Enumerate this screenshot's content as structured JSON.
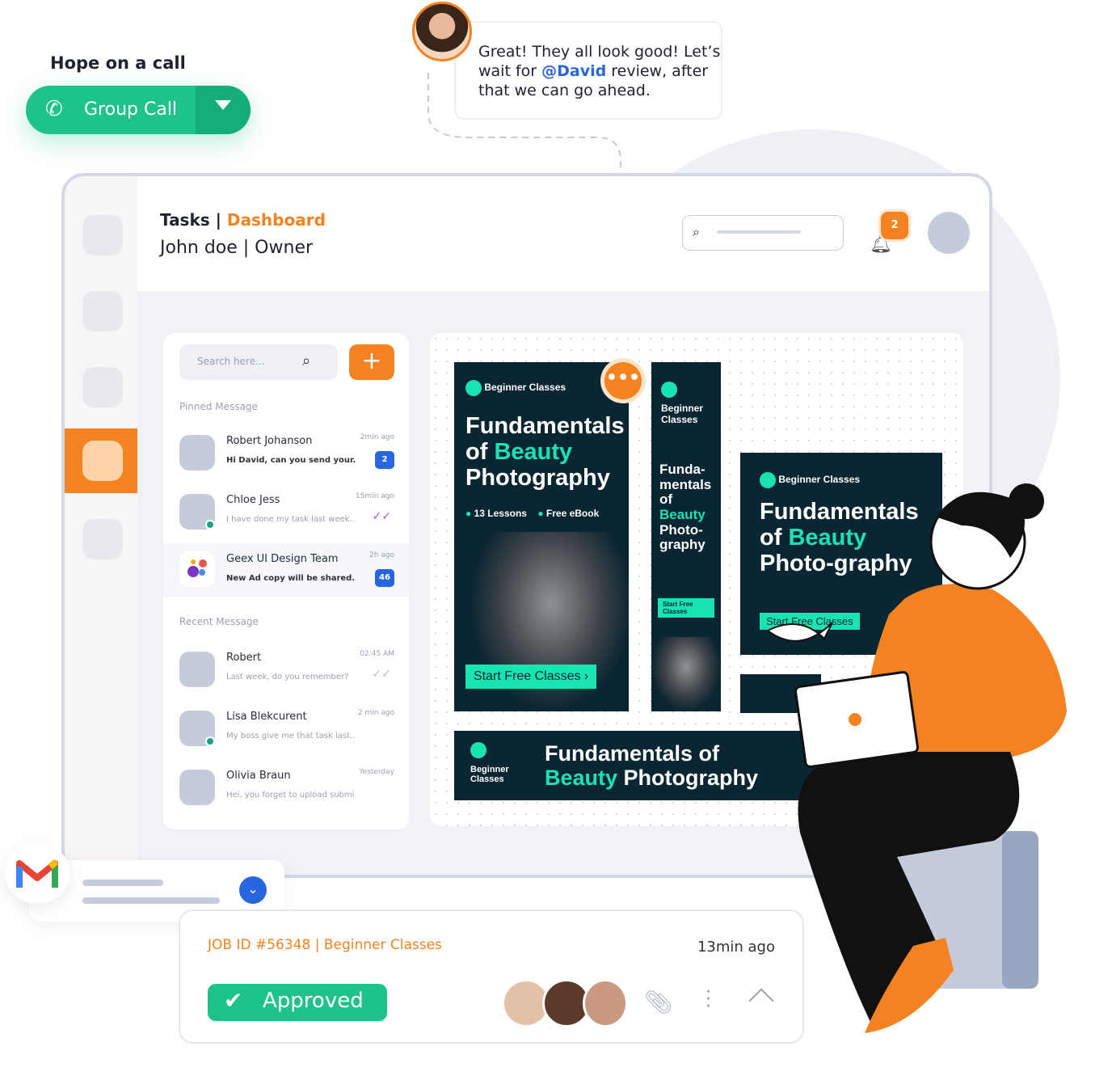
{
  "call": {
    "heading": "Hope on a call",
    "button_label": "Group Call"
  },
  "chat_bubble": {
    "text_before": "Great! They all look good! Let’s wait for ",
    "mention": "@David",
    "text_after": " review, after that we can go ahead."
  },
  "header": {
    "section": "Tasks",
    "separator": " | ",
    "page": "Dashboard",
    "user": "John doe  |  Owner",
    "notification_count": "2"
  },
  "messages": {
    "search_placeholder": "Search here...",
    "pinned_label": "Pinned Message",
    "recent_label": "Recent Message",
    "pinned": [
      {
        "name": "Robert Johanson",
        "preview": "Hi David, can you send your...",
        "time": "2min ago",
        "count": "2"
      },
      {
        "name": "Chloe Jess",
        "preview": "I have done my task last week..",
        "time": "15min ago"
      },
      {
        "name": "Geex UI Design Team",
        "preview": "New Ad copy will be shared..",
        "time": "2h ago",
        "count": "46"
      }
    ],
    "recent": [
      {
        "name": "Robert",
        "preview": "Last week, do you remember?",
        "time": "02:45 AM"
      },
      {
        "name": "Lisa Blekcurent",
        "preview": "My boss give me that task last..",
        "time": "2 min ago"
      },
      {
        "name": "Olivia Braun",
        "preview": "Hei, you forget to upload submi..",
        "time": "Yesterday"
      }
    ]
  },
  "ads": {
    "tag": "Beginner Classes",
    "title_a": "Fundamentals of ",
    "title_b": "Beauty",
    "title_c": "Photography",
    "lessons": "13 Lessons",
    "ebook": "Free eBook",
    "cta": "Start Free Classes",
    "narrow_title_a": "Funda-mentals of",
    "narrow_title_c": "Photo-graphy",
    "med_title_c": "Photo-graphy",
    "wide_title_a": "Fundamentals of",
    "wide_title_c": "Photography"
  },
  "job": {
    "title": "JOB ID #56348 | Beginner Classes",
    "time": "13min ago",
    "status": "Approved"
  },
  "colors": {
    "green": "#1ec28b",
    "orange": "#f58220",
    "navy": "#0b2633",
    "cyan": "#19e3b2",
    "blue": "#2866e0"
  }
}
